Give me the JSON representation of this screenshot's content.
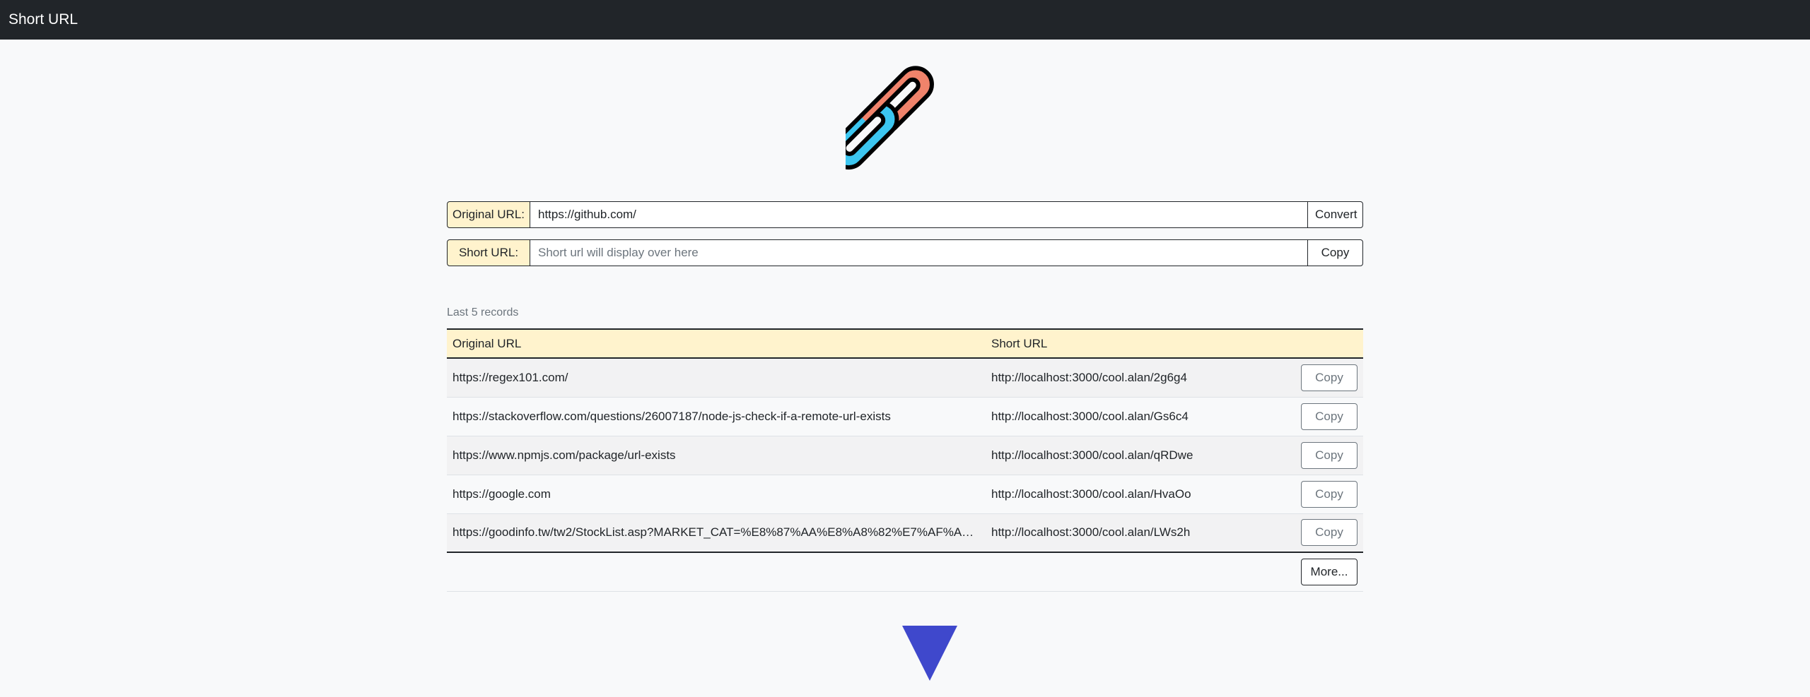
{
  "navbar": {
    "brand": "Short URL"
  },
  "logo": {
    "icon": "chain-link-icon",
    "colors": {
      "left_link": "#3cc6f0",
      "right_link": "#f0836b",
      "outline": "#000000"
    }
  },
  "form": {
    "original": {
      "label": "Original URL:",
      "value": "https://github.com/",
      "button": "Convert"
    },
    "short": {
      "label": "Short URL:",
      "placeholder": "Short url will display over here",
      "value": "",
      "button": "Copy"
    }
  },
  "records": {
    "caption": "Last 5 records",
    "headers": {
      "original": "Original URL",
      "short": "Short URL"
    },
    "copy_label": "Copy",
    "rows": [
      {
        "original": "https://regex101.com/",
        "short": "http://localhost:3000/cool.alan/2g6g4"
      },
      {
        "original": "https://stackoverflow.com/questions/26007187/node-js-check-if-a-remote-url-exists",
        "short": "http://localhost:3000/cool.alan/Gs6c4"
      },
      {
        "original": "https://www.npmjs.com/package/url-exists",
        "short": "http://localhost:3000/cool.alan/qRDwe"
      },
      {
        "original": "https://google.com",
        "short": "http://localhost:3000/cool.alan/HvaOo"
      },
      {
        "original": "https://goodinfo.tw/tw2/StockList.asp?MARKET_CAT=%E8%87%AA%E8%A8%82%E7%AF%A9%E9...",
        "short": "http://localhost:3000/cool.alan/LWs2h"
      }
    ],
    "more_label": "More..."
  },
  "scroll_arrow": {
    "icon": "triangle-down-icon",
    "color": "#3f48cc"
  },
  "colors": {
    "navbar": "#212529",
    "label_bg": "#fff3cd",
    "page_bg": "#f8f9fa"
  }
}
